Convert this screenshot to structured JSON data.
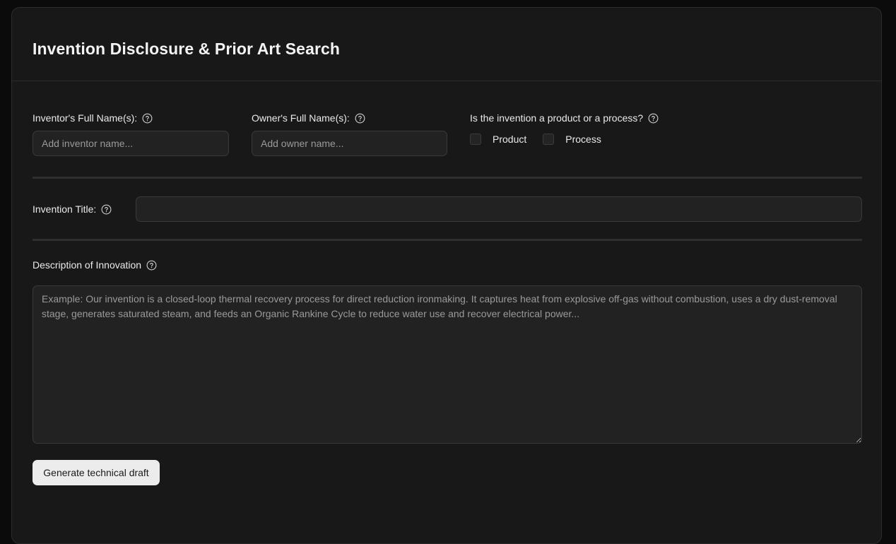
{
  "form": {
    "title": "Invention Disclosure & Prior Art Search",
    "inventor": {
      "label": "Inventor's Full Name(s):",
      "placeholder": "Add inventor name...",
      "value": ""
    },
    "owner": {
      "label": "Owner's Full Name(s):",
      "placeholder": "Add owner name...",
      "value": ""
    },
    "invention_type": {
      "label": "Is the invention a product or a process?",
      "options": [
        {
          "label": "Product",
          "checked": false
        },
        {
          "label": "Process",
          "checked": false
        }
      ]
    },
    "invention_title": {
      "label": "Invention Title:",
      "value": ""
    },
    "description": {
      "label": "Description of Innovation",
      "placeholder": "Example: Our invention is a closed-loop thermal recovery process for direct reduction ironmaking. It captures heat from explosive off-gas without combustion, uses a dry dust-removal stage, generates saturated steam, and feeds an Organic Rankine Cycle to reduce water use and recover electrical power...",
      "value": ""
    },
    "generate_button": "Generate technical draft"
  },
  "icons": {
    "help": "help-circle-icon"
  },
  "colors": {
    "page_background": "#0b0b0b",
    "card_background": "#181818",
    "input_background": "#222222",
    "button_background": "#ececec"
  }
}
